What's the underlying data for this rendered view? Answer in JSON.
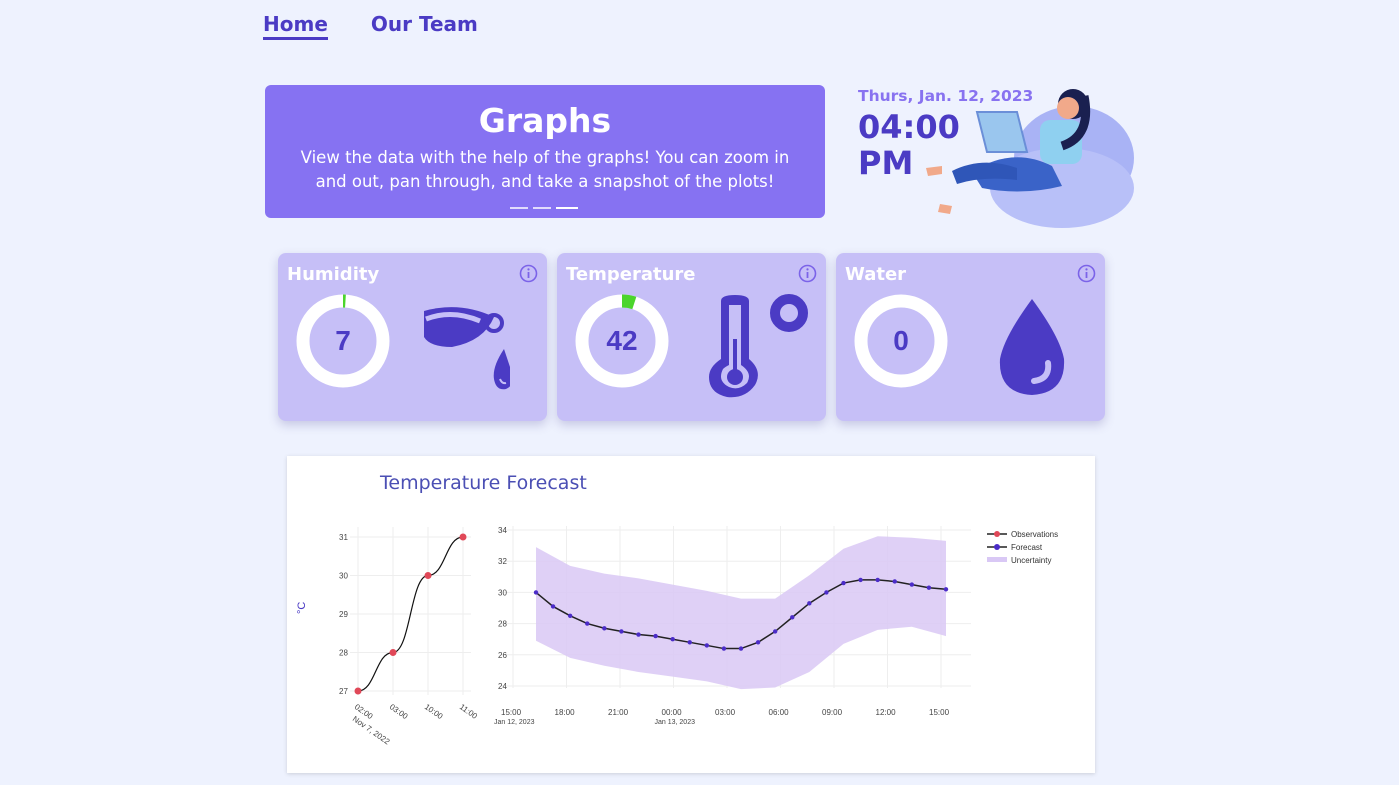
{
  "nav": {
    "items": [
      {
        "label": "Home",
        "active": true
      },
      {
        "label": "Our Team",
        "active": false
      }
    ]
  },
  "hero": {
    "title": "Graphs",
    "description": "View the data with the help of the graphs! You can zoom in and out, pan through, and take a snapshot of the plots!",
    "carousel_dots": 3,
    "active_dot": 2
  },
  "clock": {
    "date": "Thurs, Jan. 12, 2023",
    "time": "04:00 PM"
  },
  "colors": {
    "accent": "#4b3bc4",
    "hero_bg": "#8672f2",
    "card_bg": "#c6bff7",
    "gauge_fill": "#4bd52c",
    "obs": "#e04858",
    "forecast": "#4b2cc8",
    "band": "#d9c8f5"
  },
  "cards": [
    {
      "title": "Humidity",
      "value": "7",
      "level": 0.01,
      "icon": "leaf-drop-icon"
    },
    {
      "title": "Temperature",
      "value": "42",
      "level": 0.05,
      "icon": "thermometer-icon"
    },
    {
      "title": "Water",
      "value": "0",
      "level": 0,
      "icon": "water-drop-icon"
    }
  ],
  "graph": {
    "title": "Temperature Forecast"
  },
  "chart_data": [
    {
      "type": "line",
      "ylabel": "°C",
      "x_ticks": [
        "02:00",
        "03:00",
        "10:00",
        "11:00"
      ],
      "x_sublabel": "Nov 7, 2022",
      "y_ticks": [
        "27",
        "28",
        "29",
        "30",
        "31"
      ],
      "ylim": [
        27,
        31
      ],
      "series": [
        {
          "name": "Observations",
          "x": [
            "02:00",
            "03:00",
            "10:00",
            "11:00"
          ],
          "values": [
            27,
            28,
            30,
            31
          ]
        }
      ]
    },
    {
      "type": "line",
      "x_ticks": [
        "15:00",
        "18:00",
        "21:00",
        "00:00",
        "03:00",
        "06:00",
        "09:00",
        "12:00",
        "15:00"
      ],
      "x_sublabels": [
        {
          "tick": 0,
          "text": "Jan 12, 2023"
        },
        {
          "tick": 3,
          "text": "Jan 13, 2023"
        }
      ],
      "y_ticks": [
        "24",
        "26",
        "28",
        "30",
        "32",
        "34"
      ],
      "ylim": [
        23.5,
        34
      ],
      "legend": [
        "Observations",
        "Forecast",
        "Uncertainty"
      ],
      "legend_position": "right",
      "series": [
        {
          "name": "Forecast",
          "x": [
            16,
            17,
            18,
            19,
            20,
            21,
            22,
            23,
            24,
            25,
            26,
            27,
            28,
            29,
            30,
            31,
            32,
            33,
            34,
            35,
            36,
            37,
            38,
            39,
            40
          ],
          "values": [
            30.0,
            29.1,
            28.5,
            28.0,
            27.7,
            27.5,
            27.3,
            27.2,
            27.0,
            26.8,
            26.6,
            26.4,
            26.4,
            26.8,
            27.5,
            28.4,
            29.3,
            30.0,
            30.6,
            30.8,
            30.8,
            30.7,
            30.5,
            30.3,
            30.2
          ]
        },
        {
          "name": "Uncertainty",
          "x": [
            16,
            18,
            20,
            22,
            24,
            26,
            28,
            30,
            32,
            34,
            36,
            38,
            40
          ],
          "upper": [
            32.9,
            31.7,
            31.2,
            30.9,
            30.5,
            30.1,
            29.6,
            29.6,
            31.1,
            32.8,
            33.6,
            33.5,
            33.3
          ],
          "lower": [
            26.9,
            25.8,
            25.3,
            24.9,
            24.6,
            24.3,
            23.8,
            23.9,
            24.9,
            26.7,
            27.6,
            27.8,
            27.2
          ]
        }
      ]
    }
  ]
}
